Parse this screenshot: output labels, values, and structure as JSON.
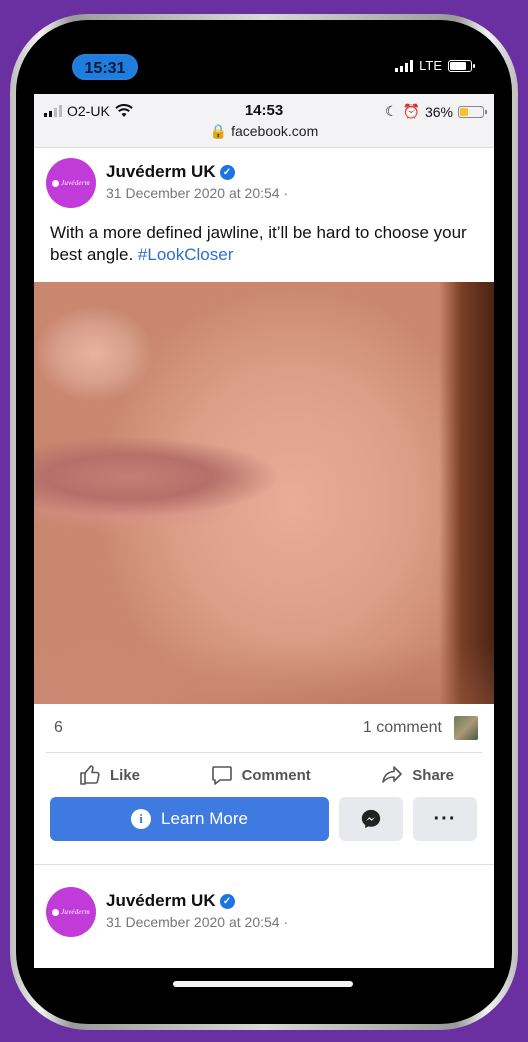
{
  "outer_status": {
    "time": "15:31",
    "network": "LTE"
  },
  "ios_status": {
    "carrier": "O2-UK",
    "time": "14:53",
    "url": "facebook.com",
    "battery": "36%",
    "battery_level": 0.36
  },
  "post": {
    "page_name": "Juvéderm UK",
    "avatar_text": "Juvéderm",
    "timestamp": "31 December 2020 at 20:54 ·",
    "text": "With a more defined jawline, it’ll be hard to choose your best angle.",
    "hashtag": "#LookCloser",
    "reactions_count": "6",
    "comments_count": "1 comment",
    "actions": {
      "like": "Like",
      "comment": "Comment",
      "share": "Share"
    },
    "cta": {
      "label": "Learn More"
    }
  },
  "next_post": {
    "page_name": "Juvéderm UK",
    "avatar_text": "Juvéderm",
    "timestamp": "31 December 2020 at 20:54 ·"
  },
  "colors": {
    "background": "#6a2fa0",
    "cta": "#3f7ae0",
    "avatar": "#c03bd8",
    "link": "#2d6fd0"
  }
}
